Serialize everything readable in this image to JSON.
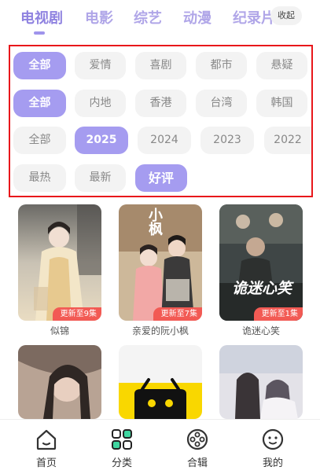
{
  "top_tabs": [
    {
      "label": "电视剧",
      "active": true
    },
    {
      "label": "电影",
      "active": false
    },
    {
      "label": "综艺",
      "active": false
    },
    {
      "label": "动漫",
      "active": false
    },
    {
      "label": "纪录片",
      "active": false
    }
  ],
  "collapse_label": "收起",
  "filters": {
    "genre": [
      "全部",
      "爱情",
      "喜剧",
      "都市",
      "悬疑"
    ],
    "genre_selected": "全部",
    "region": [
      "全部",
      "内地",
      "香港",
      "台湾",
      "韩国"
    ],
    "region_selected": "全部",
    "year": [
      "全部",
      "2025",
      "2024",
      "2023",
      "2022"
    ],
    "year_selected": "2025",
    "sort": [
      "最热",
      "最新",
      "好评"
    ],
    "sort_selected": "好评"
  },
  "videos": [
    {
      "title": "似锦",
      "badge": "更新至9集"
    },
    {
      "title": "亲爱的阮小枫",
      "badge": "更新至7集",
      "poster_text": "小枫"
    },
    {
      "title": "诡迷心笑",
      "badge": "更新至1集",
      "poster_text": "诡迷心笑"
    },
    {
      "title": "",
      "badge": ""
    },
    {
      "title": "",
      "badge": ""
    },
    {
      "title": "",
      "badge": ""
    }
  ],
  "bottom_nav": [
    {
      "label": "首页",
      "icon": "home-icon",
      "active": false
    },
    {
      "label": "分类",
      "icon": "category-icon",
      "active": true
    },
    {
      "label": "合辑",
      "icon": "collection-icon",
      "active": false
    },
    {
      "label": "我的",
      "icon": "profile-icon",
      "active": false
    }
  ],
  "colors": {
    "accent": "#a59cf0",
    "tab_active": "#8f82e0",
    "badge": "#f25a54",
    "highlight_border": "#e8171b"
  }
}
